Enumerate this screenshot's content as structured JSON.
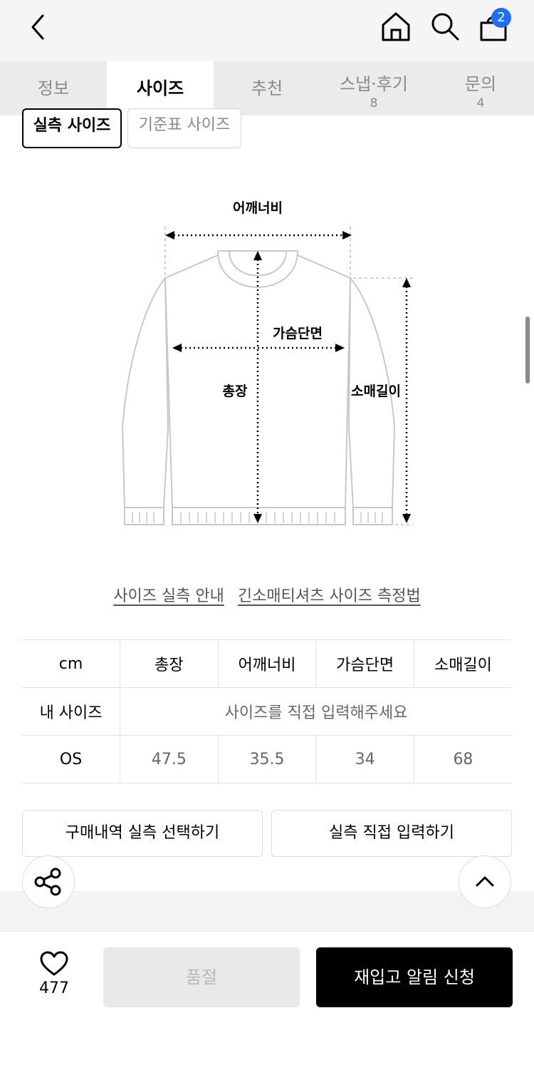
{
  "header": {
    "back_icon": "chevron-left-icon",
    "home_icon": "home-icon",
    "search_icon": "search-icon",
    "cart_icon": "shopping-bag-icon",
    "cart_badge": "2"
  },
  "tabs": [
    {
      "label": "정보",
      "count": ""
    },
    {
      "label": "사이즈",
      "count": ""
    },
    {
      "label": "추천",
      "count": ""
    },
    {
      "label": "스냅·후기",
      "count": "8"
    },
    {
      "label": "문의",
      "count": "4"
    }
  ],
  "size_toggle": {
    "actual": "실측 사이즈",
    "standard": "기준표 사이즈"
  },
  "diagram": {
    "shoulder": "어깨너비",
    "chest": "가슴단면",
    "length": "총장",
    "sleeve": "소매길이"
  },
  "links": {
    "guide": "사이즈 실측 안내",
    "method": "긴소매티셔츠 사이즈 측정법"
  },
  "size_table": {
    "unit": "cm",
    "columns": [
      "총장",
      "어깨너비",
      "가슴단면",
      "소매길이"
    ],
    "my_size_label": "내 사이즈",
    "my_size_prompt": "사이즈를 직접 입력해주세요",
    "rows": [
      {
        "name": "OS",
        "values": [
          "47.5",
          "35.5",
          "34",
          "68"
        ]
      }
    ]
  },
  "actions": {
    "select_from_purchase": "구매내역 실측 선택하기",
    "enter_manually": "실측 직접 입력하기"
  },
  "bottom": {
    "like_count": "477",
    "soldout": "품절",
    "restock": "재입고 알림 신청"
  }
}
